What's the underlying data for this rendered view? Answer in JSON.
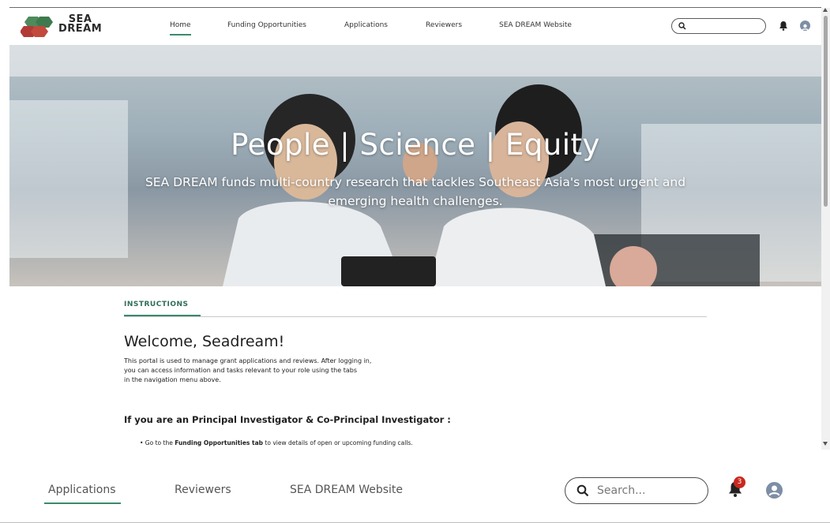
{
  "logo": {
    "line1": "SEA",
    "line2": "DREAM"
  },
  "nav": {
    "items": [
      {
        "label": "Home",
        "active": true
      },
      {
        "label": "Funding Opportunities",
        "active": false
      },
      {
        "label": "Applications",
        "active": false
      },
      {
        "label": "Reviewers",
        "active": false
      },
      {
        "label": "SEA DREAM Website",
        "active": false
      }
    ]
  },
  "hero": {
    "title": "People | Science | Equity",
    "subtitle_line1": "SEA DREAM funds multi-country research that tackles Southeast Asia's most urgent and",
    "subtitle_line2": "emerging health challenges."
  },
  "content": {
    "tab_label": "INSTRUCTIONS",
    "welcome": "Welcome, Seadream!",
    "intro_line1": "This portal is used to manage grant applications and reviews. After logging in,",
    "intro_line2": "you can access information and tasks relevant to your role using the tabs",
    "intro_line3": "in the navigation menu above.",
    "pi_heading": "If you are an Principal Investigator & Co-Principal Investigator :",
    "bullet_prefix": "• Go to the ",
    "bullet_bold": "Funding Opportunities tab",
    "bullet_suffix": " to view details of open or upcoming funding calls."
  },
  "zoom": {
    "nav_applications": "Applications",
    "nav_reviewers": "Reviewers",
    "nav_website": "SEA DREAM Website",
    "search_placeholder": "Search...",
    "notification_count": "3"
  },
  "colors": {
    "accent_green": "#3c8a6a",
    "logo_green": "#4f8a5c",
    "logo_red": "#b23a36",
    "badge_red": "#c8281f"
  }
}
